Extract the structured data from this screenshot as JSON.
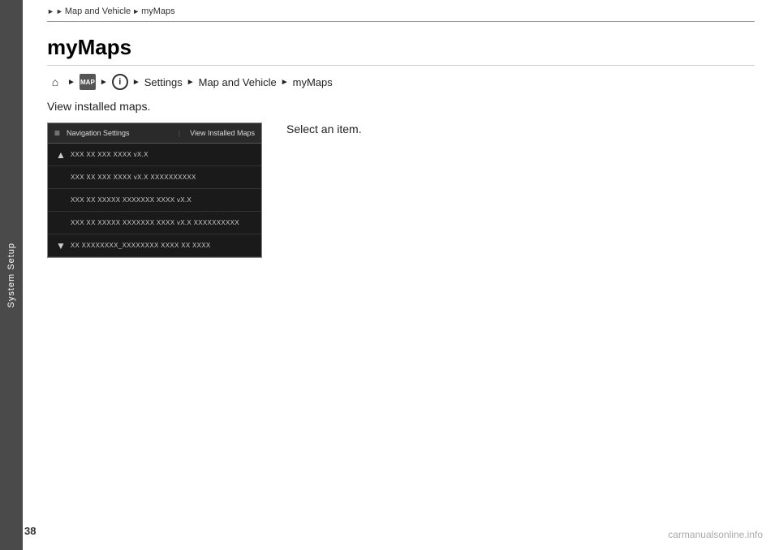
{
  "sidebar": {
    "label": "System Setup"
  },
  "breadcrumb": {
    "items": [
      "Map and Vehicle",
      "myMaps"
    ],
    "arrows": [
      "▶",
      "▶"
    ]
  },
  "page": {
    "title": "myMaps",
    "page_number": "38"
  },
  "nav_path": {
    "items": [
      "Settings",
      "Map and Vehicle",
      "myMaps"
    ],
    "arrows": [
      "▶",
      "▶",
      "▶",
      "▶",
      "▶"
    ]
  },
  "content": {
    "description": "View installed maps.",
    "select_instruction": "Select an item."
  },
  "screen": {
    "header_left": "Navigation Settings",
    "header_divider": "|",
    "header_right": "View Installed Maps",
    "rows": [
      {
        "icon": "upload",
        "text": "XXX  XX XXX  XXXX vX.X"
      },
      {
        "icon": "none",
        "text": "XXX  XX XXX  XXXX vX.X XXXXXXXXXX"
      },
      {
        "icon": "none",
        "text": "XXX  XX XXXXX XXXXXXX XXXX vX.X"
      },
      {
        "icon": "none",
        "text": "XXX  XX XXXXX XXXXXXX XXXX vX.X XXXXXXXXXX"
      },
      {
        "icon": "down",
        "text": "XX XXXXXXXX_XXXXXXXX XXXX XX XXXX"
      }
    ]
  },
  "icons": {
    "home_icon": "⌂",
    "map_text": "MAP",
    "info_text": "i",
    "menu_icon": "≡",
    "arrow_right": "▶",
    "arrow_small": "►"
  },
  "watermark": "carmanualsonline.info"
}
